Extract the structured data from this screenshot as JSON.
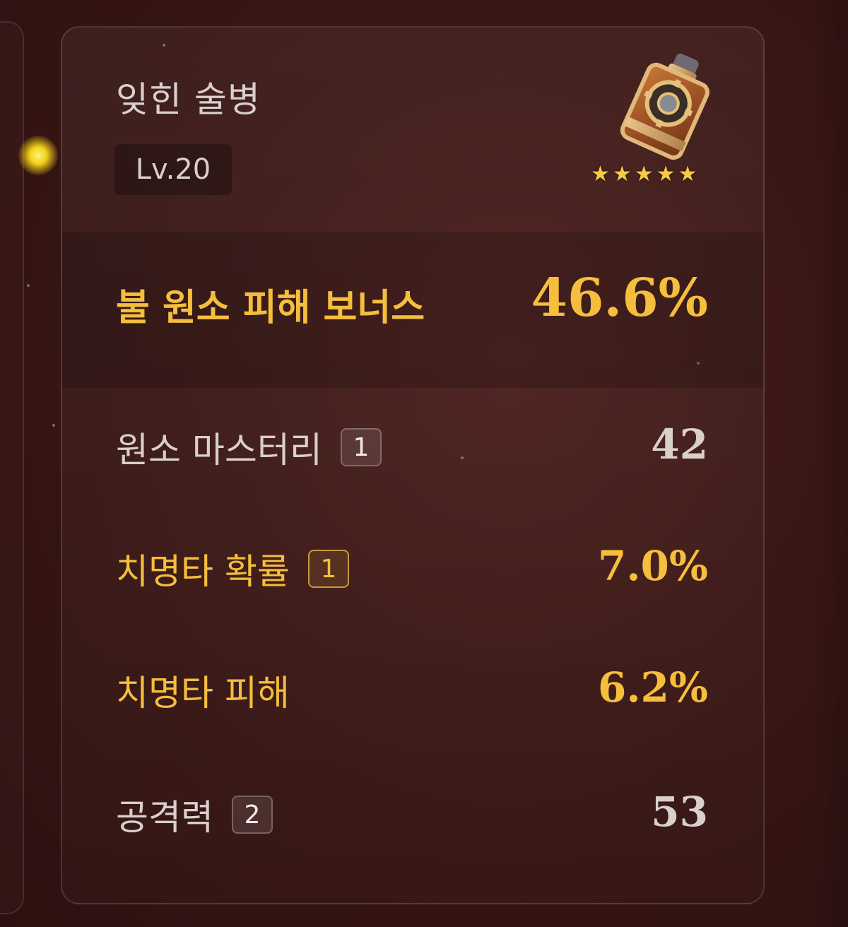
{
  "artifact": {
    "name": "잊힌 술병",
    "level": "Lv.20",
    "rarity_stars": "★★★★★",
    "icon": "artifact-goblet-icon"
  },
  "main_stat": {
    "name": "불 원소 피해 보너스",
    "value": "46.6%"
  },
  "sub_stats": [
    {
      "name": "원소 마스터리",
      "rolls": "1",
      "value": "42"
    },
    {
      "name": "치명타 확률",
      "rolls": "1",
      "value": "7.0%"
    },
    {
      "name": "치명타 피해",
      "value": "6.2%"
    },
    {
      "name": "공격력",
      "rolls": "2",
      "value": "53"
    }
  ],
  "colors": {
    "gold": "#f5be3c",
    "text": "#d9cfcb",
    "background": "#3a1715"
  }
}
